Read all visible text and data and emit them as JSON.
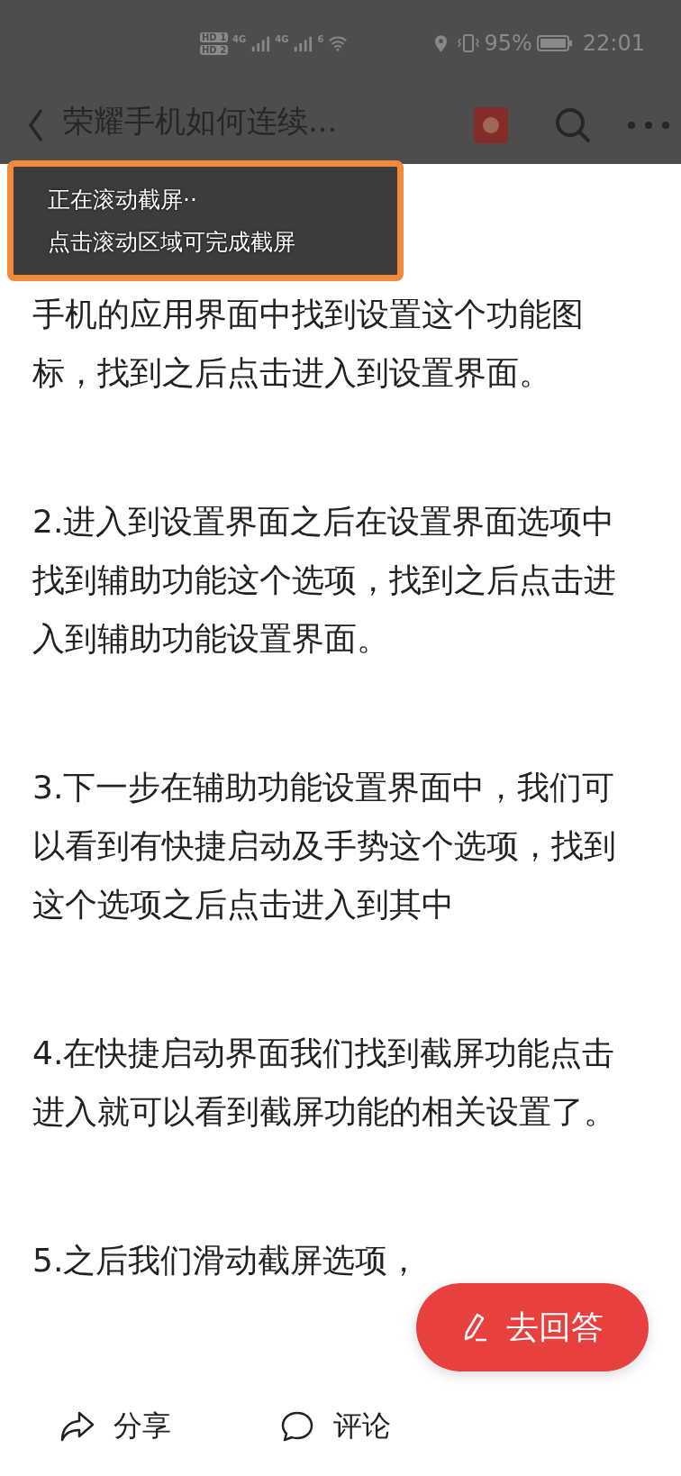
{
  "status_bar": {
    "sim_labels": [
      "HD 1",
      "HD 2"
    ],
    "network_1": "4G",
    "network_2": "4G",
    "wifi_label": "6",
    "battery": "95%",
    "time": "22:01"
  },
  "header": {
    "title": "荣耀手机如何连续..."
  },
  "toast": {
    "lines": [
      "正在滚动截屏··",
      "点击滚动区域可完成截屏"
    ]
  },
  "article": {
    "paragraphs": [
      "手机的应用界面中找到设置这个功能图标，找到之后点击进入到设置界面。",
      "2.进入到设置界面之后在设置界面选项中找到辅助功能这个选项，找到之后点击进入到辅助功能设置界面。",
      "3.下一步在辅助功能设置界面中，我们可以看到有快捷启动及手势这个选项，找到这个选项之后点击进入到其中",
      "4.在快捷启动界面我们找到截屏功能点击进入就可以看到截屏功能的相关设置了。",
      "5.之后我们滑动截屏选项，"
    ]
  },
  "answer_button": {
    "label": "去回答"
  },
  "bottom_bar": {
    "items": [
      {
        "kind": "share",
        "label": "分享"
      },
      {
        "kind": "comment",
        "label": "评论"
      }
    ]
  }
}
